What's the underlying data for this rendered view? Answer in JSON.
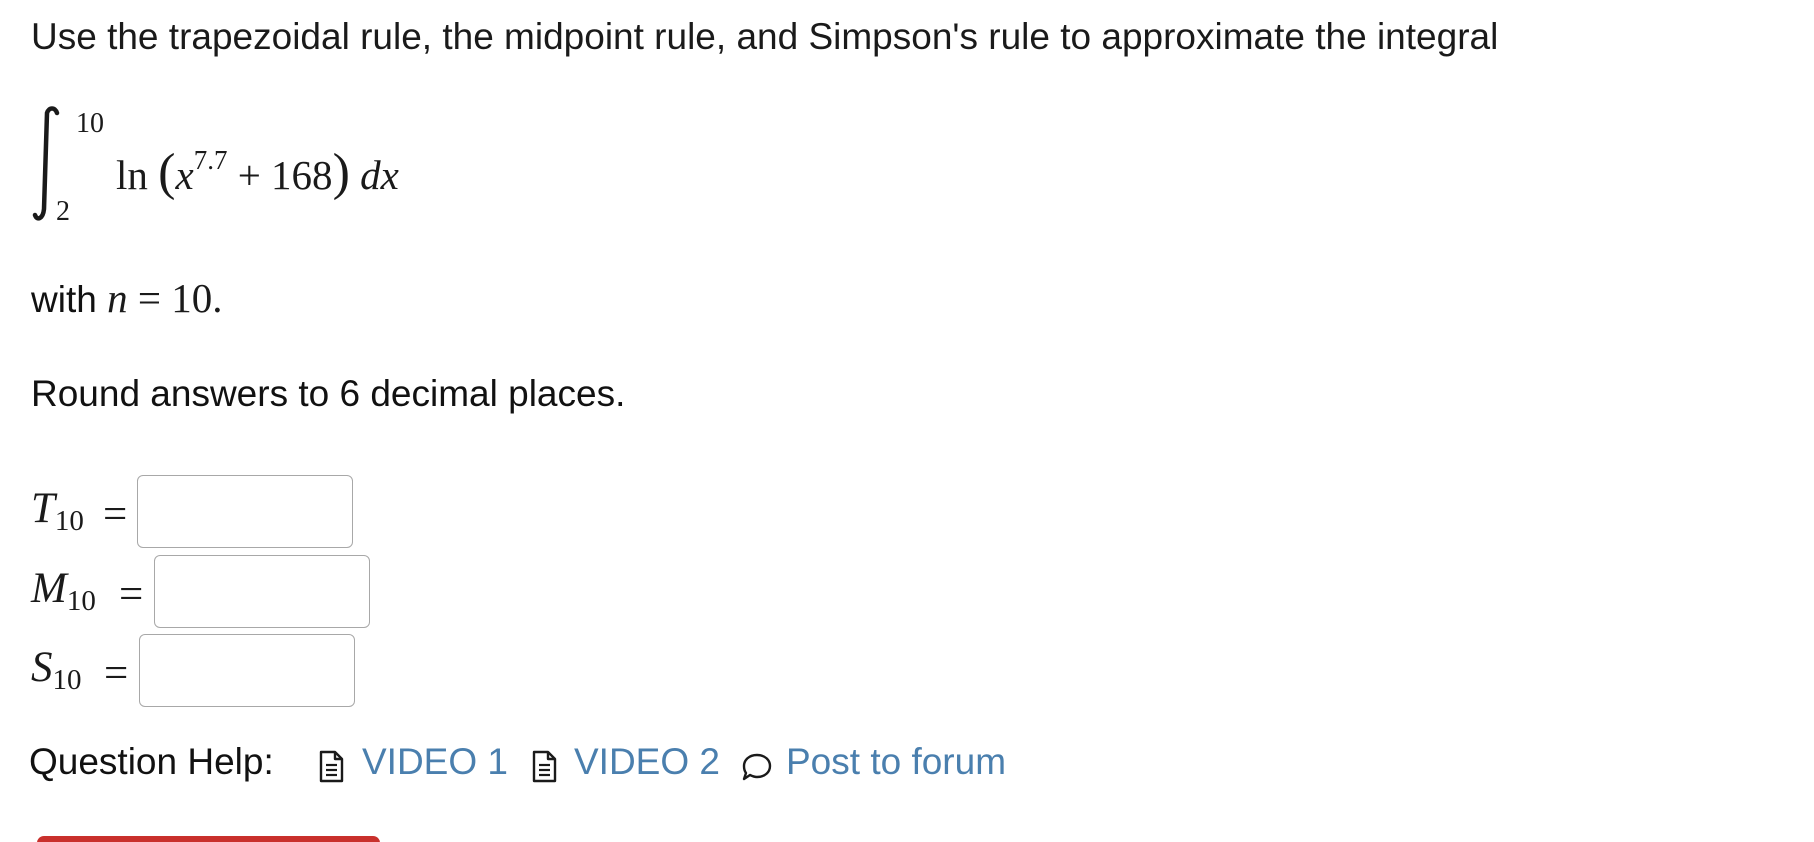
{
  "prompt": {
    "text": "Use the trapezoidal rule, the midpoint rule, and Simpson's rule to approximate the integral"
  },
  "integral": {
    "upper_limit": "10",
    "lower_limit": "2",
    "fn": "ln",
    "base": "x",
    "exponent": "7.7",
    "rest": "+ 168",
    "differential": "dx"
  },
  "n_statement": {
    "prefix": "with",
    "var": "n",
    "equals": "=",
    "value": "10."
  },
  "instructions": "Round answers to 6 decimal places.",
  "answers": [
    {
      "letter": "T",
      "sub": "10",
      "equals": "=",
      "value": ""
    },
    {
      "letter": "M",
      "sub": "10",
      "equals": "=",
      "value": ""
    },
    {
      "letter": "S",
      "sub": "10",
      "equals": "=",
      "value": ""
    }
  ],
  "question_help": {
    "label": "Question Help:",
    "video1": "VIDEO 1",
    "video2": "VIDEO 2",
    "forum": "Post to forum"
  },
  "colors": {
    "link": "#4a7fae",
    "submit": "#c9302c",
    "input_border": "#a8a8a8"
  },
  "icons": [
    "document-icon",
    "document-icon",
    "speech-bubble-icon"
  ]
}
